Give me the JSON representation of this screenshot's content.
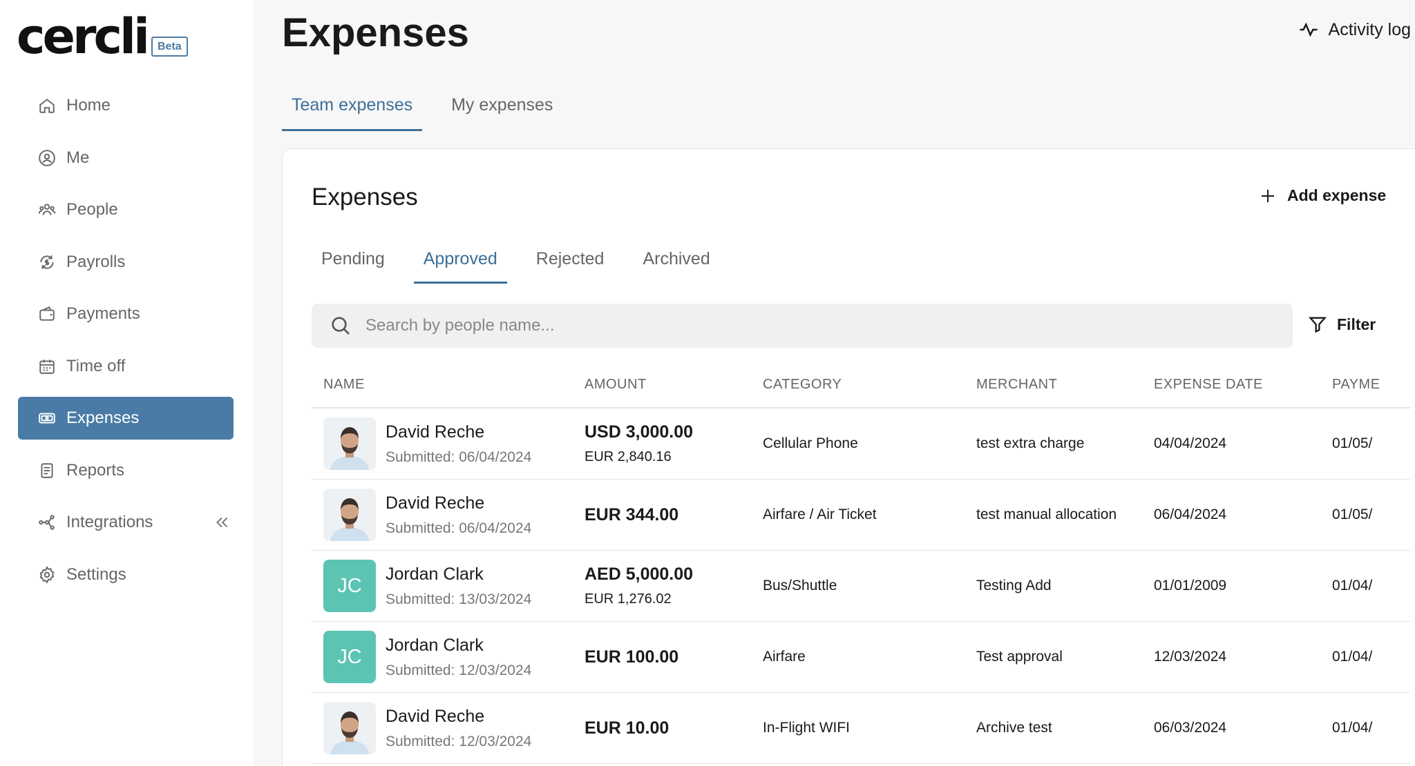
{
  "brand": {
    "name": "cercli",
    "badge": "Beta"
  },
  "sidebar": {
    "items": [
      {
        "label": "Home",
        "icon": "home-icon"
      },
      {
        "label": "Me",
        "icon": "user-circle-icon"
      },
      {
        "label": "People",
        "icon": "people-icon"
      },
      {
        "label": "Payrolls",
        "icon": "payroll-icon"
      },
      {
        "label": "Payments",
        "icon": "wallet-icon"
      },
      {
        "label": "Time off",
        "icon": "calendar-icon"
      },
      {
        "label": "Expenses",
        "icon": "expenses-icon",
        "active": true
      },
      {
        "label": "Reports",
        "icon": "report-icon"
      },
      {
        "label": "Integrations",
        "icon": "integrations-icon"
      },
      {
        "label": "Settings",
        "icon": "gear-icon"
      }
    ]
  },
  "header": {
    "title": "Expenses",
    "activity_label": "Activity log"
  },
  "top_tabs": [
    {
      "label": "Team expenses",
      "active": true
    },
    {
      "label": "My expenses",
      "active": false
    }
  ],
  "card": {
    "title": "Expenses",
    "add_label": "Add expense",
    "status_tabs": [
      {
        "label": "Pending",
        "active": false
      },
      {
        "label": "Approved",
        "active": true
      },
      {
        "label": "Rejected",
        "active": false
      },
      {
        "label": "Archived",
        "active": false
      }
    ],
    "search_placeholder": "Search by people name...",
    "filter_label": "Filter"
  },
  "table": {
    "columns": [
      "NAME",
      "AMOUNT",
      "CATEGORY",
      "MERCHANT",
      "EXPENSE DATE",
      "PAYME"
    ],
    "rows": [
      {
        "name": "David Reche",
        "submitted": "Submitted: 06/04/2024",
        "avatar": "photo",
        "amount": "USD 3,000.00",
        "amount_sub": "EUR 2,840.16",
        "category": "Cellular Phone",
        "merchant": "test extra charge",
        "expense_date": "04/04/2024",
        "payment": "01/05/"
      },
      {
        "name": "David Reche",
        "submitted": "Submitted: 06/04/2024",
        "avatar": "photo",
        "amount": "EUR 344.00",
        "amount_sub": "",
        "category": "Airfare / Air Ticket",
        "merchant": "test manual allocation",
        "expense_date": "06/04/2024",
        "payment": "01/05/"
      },
      {
        "name": "Jordan Clark",
        "submitted": "Submitted: 13/03/2024",
        "avatar": "JC",
        "amount": "AED 5,000.00",
        "amount_sub": "EUR 1,276.02",
        "category": "Bus/Shuttle",
        "merchant": "Testing Add",
        "expense_date": "01/01/2009",
        "payment": "01/04/"
      },
      {
        "name": "Jordan Clark",
        "submitted": "Submitted: 12/03/2024",
        "avatar": "JC",
        "amount": "EUR 100.00",
        "amount_sub": "",
        "category": "Airfare",
        "merchant": "Test approval",
        "expense_date": "12/03/2024",
        "payment": "01/04/"
      },
      {
        "name": "David Reche",
        "submitted": "Submitted: 12/03/2024",
        "avatar": "photo",
        "amount": "EUR 10.00",
        "amount_sub": "",
        "category": "In-Flight WIFI",
        "merchant": "Archive test",
        "expense_date": "06/03/2024",
        "payment": "01/04/"
      }
    ]
  },
  "colors": {
    "accent": "#4a7ba6",
    "initials_bg": "#5cc4b2"
  }
}
